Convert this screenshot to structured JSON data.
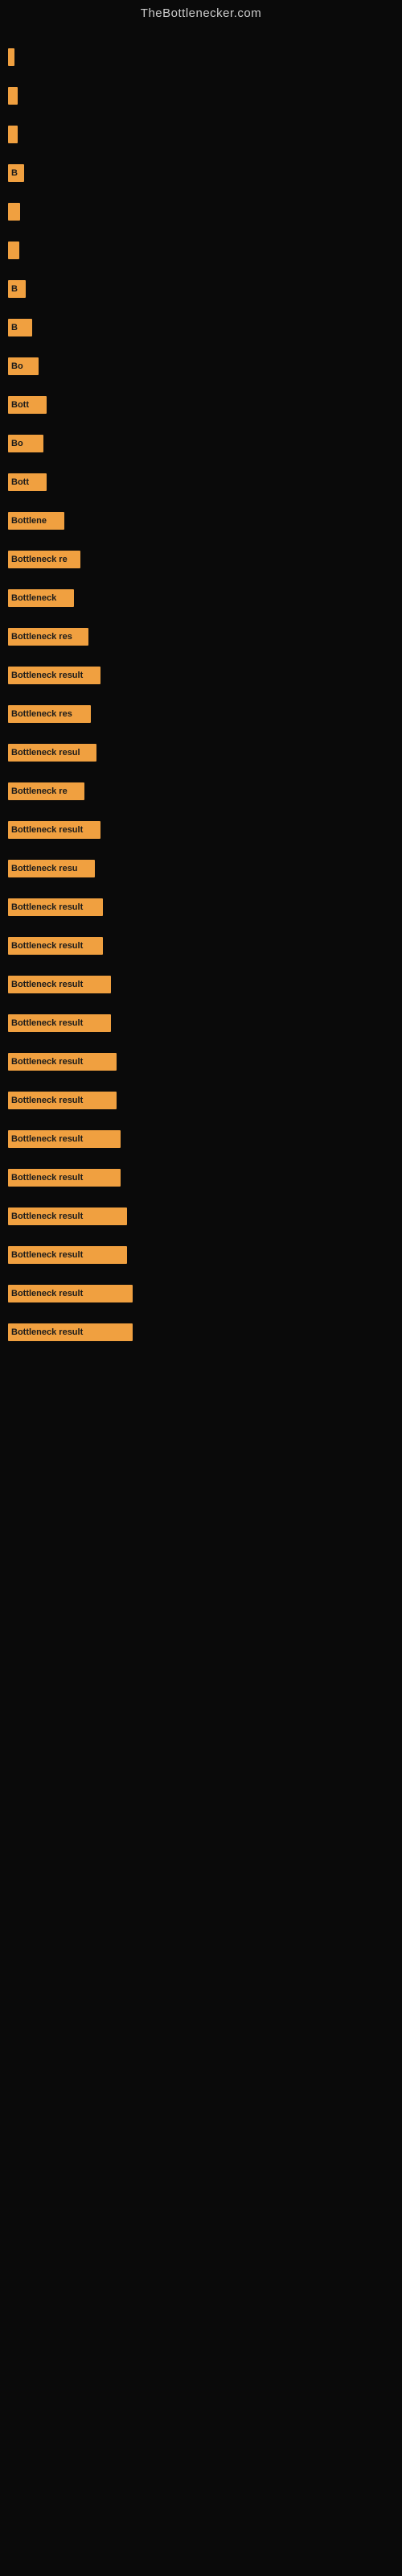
{
  "site": {
    "title": "TheBottlenecker.com"
  },
  "bars": [
    {
      "width": 8,
      "label": ""
    },
    {
      "width": 12,
      "label": ""
    },
    {
      "width": 12,
      "label": ""
    },
    {
      "width": 20,
      "label": "B"
    },
    {
      "width": 15,
      "label": ""
    },
    {
      "width": 14,
      "label": ""
    },
    {
      "width": 22,
      "label": "B"
    },
    {
      "width": 30,
      "label": "B"
    },
    {
      "width": 38,
      "label": "Bo"
    },
    {
      "width": 48,
      "label": "Bott"
    },
    {
      "width": 44,
      "label": "Bo"
    },
    {
      "width": 48,
      "label": "Bott"
    },
    {
      "width": 70,
      "label": "Bottlene"
    },
    {
      "width": 90,
      "label": "Bottleneck re"
    },
    {
      "width": 82,
      "label": "Bottleneck"
    },
    {
      "width": 100,
      "label": "Bottleneck res"
    },
    {
      "width": 115,
      "label": "Bottleneck result"
    },
    {
      "width": 103,
      "label": "Bottleneck res"
    },
    {
      "width": 110,
      "label": "Bottleneck resul"
    },
    {
      "width": 95,
      "label": "Bottleneck re"
    },
    {
      "width": 115,
      "label": "Bottleneck result"
    },
    {
      "width": 108,
      "label": "Bottleneck resu"
    },
    {
      "width": 118,
      "label": "Bottleneck result"
    },
    {
      "width": 118,
      "label": "Bottleneck result"
    },
    {
      "width": 128,
      "label": "Bottleneck result"
    },
    {
      "width": 128,
      "label": "Bottleneck result"
    },
    {
      "width": 135,
      "label": "Bottleneck result"
    },
    {
      "width": 135,
      "label": "Bottleneck result"
    },
    {
      "width": 140,
      "label": "Bottleneck result"
    },
    {
      "width": 140,
      "label": "Bottleneck result"
    },
    {
      "width": 148,
      "label": "Bottleneck result"
    },
    {
      "width": 148,
      "label": "Bottleneck result"
    },
    {
      "width": 155,
      "label": "Bottleneck result"
    },
    {
      "width": 155,
      "label": "Bottleneck result"
    }
  ]
}
